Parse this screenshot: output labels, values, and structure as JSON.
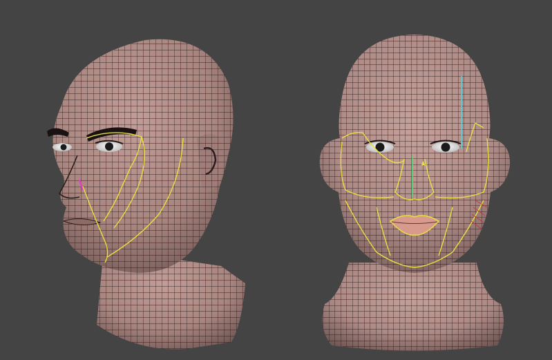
{
  "viewport": {
    "background": "#444444"
  },
  "models": [
    {
      "id": "head-three-quarter",
      "view": "three-quarter",
      "skin_color": "#b48f8b",
      "skin_shadow": "#6e5553",
      "wire_color": "#1e1414",
      "brow_color": "#1a1212",
      "guide_color": "#e8e040",
      "accent_color": "#e040c0"
    },
    {
      "id": "head-front",
      "view": "front",
      "skin_color": "#b8938f",
      "skin_shadow": "#6e5553",
      "wire_color": "#1e1414",
      "lip_color": "#d89a8c",
      "guide_color": "#e8e040",
      "accent_cyan": "#40d8e0",
      "accent_green": "#40e070",
      "accent_red": "#c03a3a"
    }
  ]
}
